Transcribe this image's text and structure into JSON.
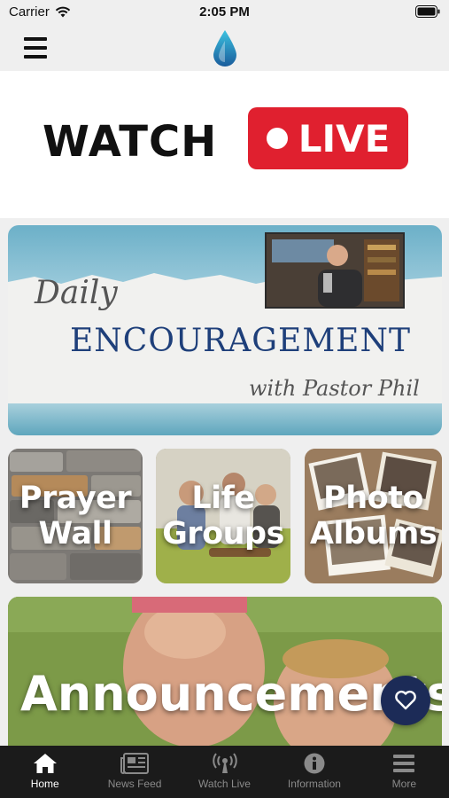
{
  "status_bar": {
    "carrier": "Carrier",
    "time": "2:05 PM"
  },
  "header": {
    "menu_icon": "hamburger-menu-icon",
    "logo_icon": "water-drop-logo-icon"
  },
  "watch_banner": {
    "watch_label": "WATCH",
    "live_label": "LIVE",
    "accent_color": "#e0202f"
  },
  "encouragement": {
    "line1": "Daily",
    "line2": "ENCOURAGEMENT",
    "line3": "with Pastor Phil"
  },
  "tiles": [
    {
      "label_line1": "Prayer",
      "label_line2": "Wall"
    },
    {
      "label_line1": "Life",
      "label_line2": "Groups"
    },
    {
      "label_line1": "Photo",
      "label_line2": "Albums"
    }
  ],
  "announcements": {
    "label": "Announcements"
  },
  "tab_bar": {
    "active_index": 0,
    "items": [
      {
        "label": "Home",
        "icon": "home-icon"
      },
      {
        "label": "News Feed",
        "icon": "newspaper-icon"
      },
      {
        "label": "Watch Live",
        "icon": "broadcast-icon"
      },
      {
        "label": "Information",
        "icon": "info-icon"
      },
      {
        "label": "More",
        "icon": "more-menu-icon"
      }
    ]
  }
}
